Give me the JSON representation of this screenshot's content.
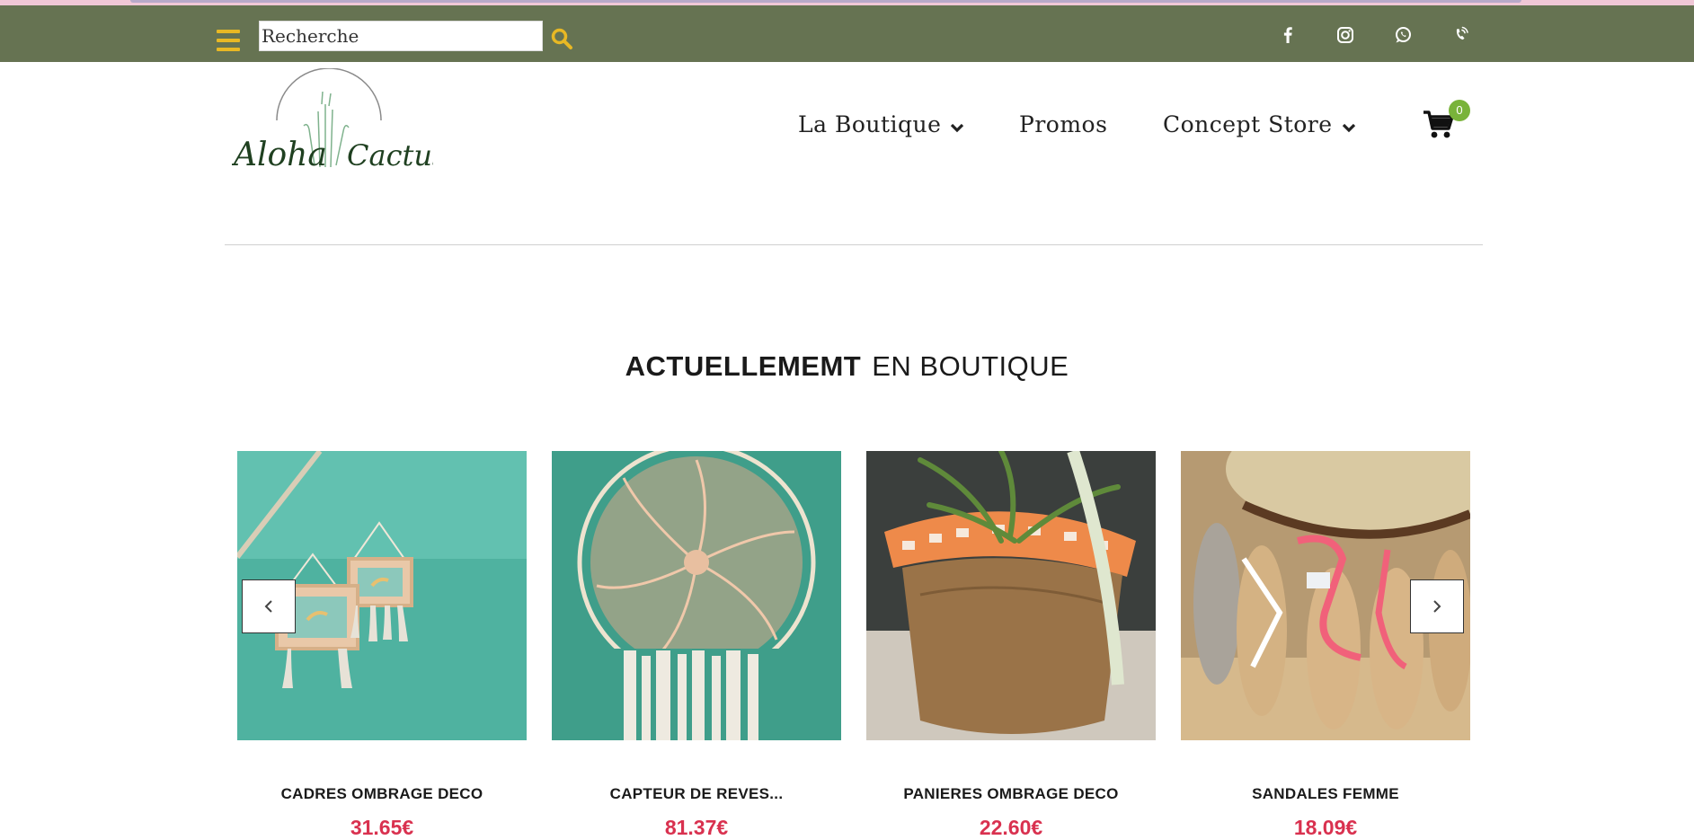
{
  "header": {
    "search": {
      "placeholder": "Recherche",
      "value": ""
    },
    "accent_color": "#e8b824",
    "bar_color": "#667352",
    "social_icons": [
      "facebook-icon",
      "instagram-icon",
      "whatsapp-icon",
      "phone-icon"
    ]
  },
  "brand": {
    "logo_text_1": "Aloha",
    "logo_text_2": "Cactus"
  },
  "nav": {
    "items": [
      {
        "label": "La Boutique"
      },
      {
        "label": "Promos"
      },
      {
        "label": "Concept Store"
      }
    ],
    "cart_count": "0"
  },
  "section": {
    "title_bold": "ACTUELLEMEMT",
    "title_light": "EN BOUTIQUE"
  },
  "products": [
    {
      "name": "CADRES OMBRAGE DECO",
      "price": "31.65€"
    },
    {
      "name": "CAPTEUR DE REVES...",
      "price": "81.37€"
    },
    {
      "name": "PANIERES OMBRAGE DECO",
      "price": "22.60€"
    },
    {
      "name": "SANDALES FEMME",
      "price": "18.09€"
    }
  ],
  "colors": {
    "price": "#d9314f",
    "badge": "#79b33a"
  }
}
